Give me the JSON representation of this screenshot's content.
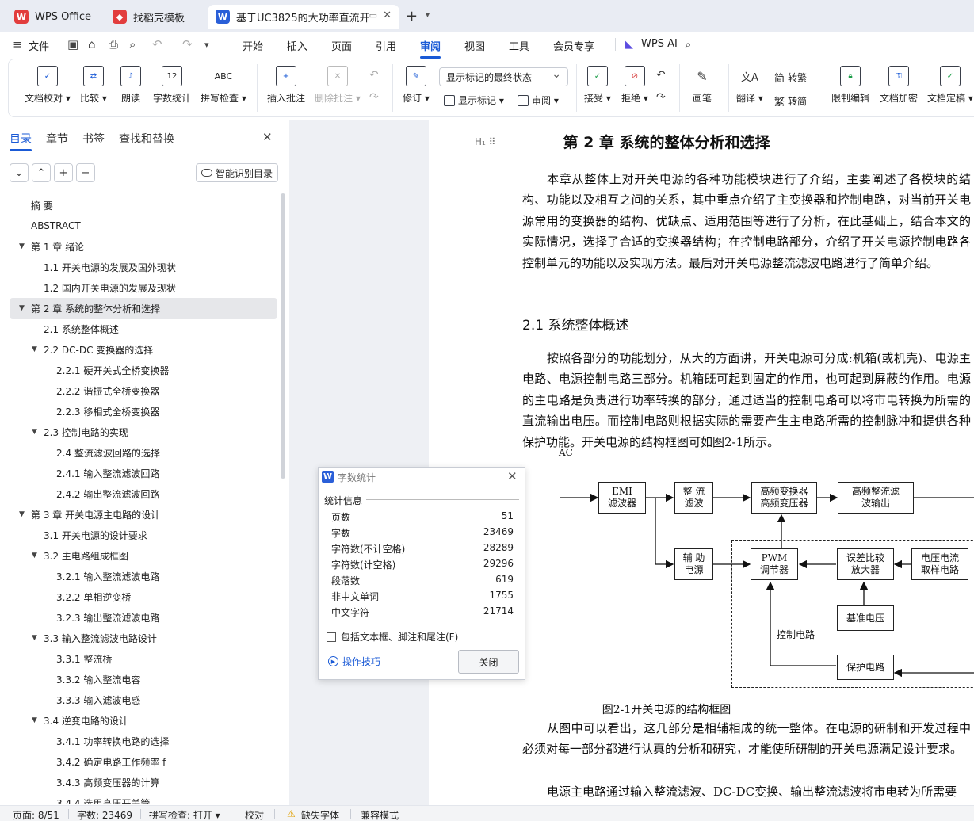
{
  "tabs": [
    {
      "label": "WPS Office",
      "icon": "wps-logo-icon",
      "color": "#e23d3d"
    },
    {
      "label": "找稻壳模板",
      "icon": "docer-icon",
      "color": "#e23d3d"
    },
    {
      "label": "基于UC3825的大功率直流开关",
      "icon": "word-doc-icon",
      "color": "#2a5fd8"
    }
  ],
  "menu": {
    "file": "文件",
    "items": [
      "开始",
      "插入",
      "页面",
      "引用",
      "审阅",
      "视图",
      "工具",
      "会员专享"
    ],
    "active": "审阅",
    "wps_ai": "WPS AI"
  },
  "ribbon": {
    "doc_check": "文档校对",
    "compare": "比较",
    "read_aloud": "朗读",
    "word_count": "字数统计",
    "spell_check": "拼写检查",
    "insert_comment": "插入批注",
    "delete_comment": "删除批注",
    "revise": "修订",
    "markup_select": "显示标记的最终状态",
    "show_markup": "显示标记",
    "review": "审阅",
    "accept": "接受",
    "reject": "拒绝",
    "pen": "画笔",
    "translate": "翻译",
    "to_traditional": "转繁",
    "to_simplified": "转简",
    "restrict_edit": "限制编辑",
    "encrypt": "文档加密",
    "finalize": "文档定稿",
    "abc": "ABC",
    "count_icon": "12"
  },
  "nav": {
    "tabs": [
      "目录",
      "章节",
      "书签",
      "查找和替换"
    ],
    "active": "目录",
    "smart_toc": "智能识别目录",
    "toc": [
      {
        "label": "摘  要",
        "level": 0,
        "arrow": false
      },
      {
        "label": "ABSTRACT",
        "level": 0,
        "arrow": false
      },
      {
        "label": "第 1 章  绪论",
        "level": 0,
        "arrow": true
      },
      {
        "label": "1.1  开关电源的发展及国外现状",
        "level": 1,
        "arrow": false
      },
      {
        "label": "1.2  国内开关电源的发展及现状",
        "level": 1,
        "arrow": false
      },
      {
        "label": "第 2 章  系统的整体分析和选择",
        "level": 0,
        "arrow": true,
        "selected": true
      },
      {
        "label": "2.1  系统整体概述",
        "level": 1,
        "arrow": false
      },
      {
        "label": "2.2 DC-DC 变换器的选择",
        "level": 1,
        "arrow": true
      },
      {
        "label": "2.2.1  硬开关式全桥变换器",
        "level": 2,
        "arrow": false
      },
      {
        "label": "2.2.2  谐振式全桥变换器",
        "level": 2,
        "arrow": false
      },
      {
        "label": "2.2.3  移相式全桥变换器",
        "level": 2,
        "arrow": false
      },
      {
        "label": "2.3  控制电路的实现",
        "level": 1,
        "arrow": true
      },
      {
        "label": "2.4  整流滤波回路的选择",
        "level": 2,
        "arrow": false
      },
      {
        "label": "2.4.1  输入整流滤波回路",
        "level": 2,
        "arrow": false
      },
      {
        "label": "2.4.2  输出整流滤波回路",
        "level": 2,
        "arrow": false
      },
      {
        "label": "第 3 章  开关电源主电路的设计",
        "level": 0,
        "arrow": true
      },
      {
        "label": "3.1  开关电源的设计要求",
        "level": 1,
        "arrow": false
      },
      {
        "label": "3.2  主电路组成框图",
        "level": 1,
        "arrow": true
      },
      {
        "label": "3.2.1  输入整流滤波电路",
        "level": 2,
        "arrow": false
      },
      {
        "label": "3.2.2  单相逆变桥",
        "level": 2,
        "arrow": false
      },
      {
        "label": "3.2.3  输出整流滤波电路",
        "level": 2,
        "arrow": false
      },
      {
        "label": "3.3  输入整流滤波电路设计",
        "level": 1,
        "arrow": true
      },
      {
        "label": "3.3.1  整流桥",
        "level": 2,
        "arrow": false
      },
      {
        "label": "3.3.2  输入整流电容",
        "level": 2,
        "arrow": false
      },
      {
        "label": "3.3.3  输入滤波电感",
        "level": 2,
        "arrow": false
      },
      {
        "label": "3.4  逆变电路的设计",
        "level": 1,
        "arrow": true
      },
      {
        "label": "3.4.1  功率转换电路的选择",
        "level": 2,
        "arrow": false
      },
      {
        "label": "3.4.2  确定电路工作频率 f",
        "level": 2,
        "arrow": false
      },
      {
        "label": "3.4.3  高频变压器的计算",
        "level": 2,
        "arrow": false
      },
      {
        "label": "3.4.4  选用高压开关管",
        "level": 2,
        "arrow": false
      }
    ]
  },
  "doc": {
    "heading_mark": "H₁ ⠿",
    "chapter_title": "第 2 章  系统的整体分析和选择",
    "para1": "本章从整体上对开关电源的各种功能模块进行了介绍，主要阐述了各模块的结构、功能以及相互之间的关系，其中重点介绍了主变换器和控制电路，对当前开关电源常用的变换器的结构、优缺点、适用范围等进行了分析，在此基础上，结合本文的实际情况，选择了合适的变换器结构；在控制电路部分，介绍了开关电源控制电路各控制单元的功能以及实现方法。最后对开关电源整流滤波电路进行了简单介绍。",
    "section_title": "2.1  系统整体概述",
    "para2": "按照各部分的功能划分，从大的方面讲，开关电源可分成:机箱(或机壳)、电源主电路、电源控制电路三部分。机箱既可起到固定的作用，也可起到屏蔽的作用。电源的主电路是负责进行功率转换的部分，通过适当的控制电路可以将市电转换为所需的直流输出电压。而控制电路则根据实际的需要产生主电路所需的控制脉冲和提供各种保护功能。开关电源的结构框图可如图2-1所示。",
    "figure_caption": "图2-1开关电源的结构框图",
    "para3": "从图中可以看出，这几部分是相辅相成的统一整体。在电源的研制和开发过程中必须对每一部分都进行认真的分析和研究，才能使所研制的开关电源满足设计要求。",
    "para4": "电源主电路通过输入整流滤波、DC-DC变换、输出整流滤波将市电转为所需要"
  },
  "diagram": {
    "ac": "AC",
    "emi": "EMI\n滤波器",
    "rectify": "整 流\n滤波",
    "hf_converter": "高频变换器\n高频变压器",
    "hf_output": "高频整流滤\n波输出",
    "aux_power": "辅 助\n电源",
    "pwm": "PWM\n调节器",
    "error_amp": "误差比较\n放大器",
    "sampling": "电压电流\n取样电路",
    "reference": "基准电压",
    "protection": "保护电路",
    "control_label": "控制电路"
  },
  "dialog": {
    "title": "字数统计",
    "section": "统计信息",
    "stats": [
      {
        "label": "页数",
        "value": "51"
      },
      {
        "label": "字数",
        "value": "23469"
      },
      {
        "label": "字符数(不计空格)",
        "value": "28289"
      },
      {
        "label": "字符数(计空格)",
        "value": "29296"
      },
      {
        "label": "段落数",
        "value": "619"
      },
      {
        "label": "非中文单词",
        "value": "1755"
      },
      {
        "label": "中文字符",
        "value": "21714"
      }
    ],
    "checkbox": "包括文本框、脚注和尾注(F)",
    "tips": "操作技巧",
    "close": "关闭"
  },
  "status": {
    "page": "页面: 8/51",
    "words": "字数: 23469",
    "spell": "拼写检查: 打开",
    "proof": "校对",
    "missing_font": "缺失字体",
    "compat": "兼容模式"
  },
  "colors": {
    "accent": "#1a5ad6",
    "tab_bg": "#e9ecf3",
    "selected_toc": "#e6e7ea"
  }
}
